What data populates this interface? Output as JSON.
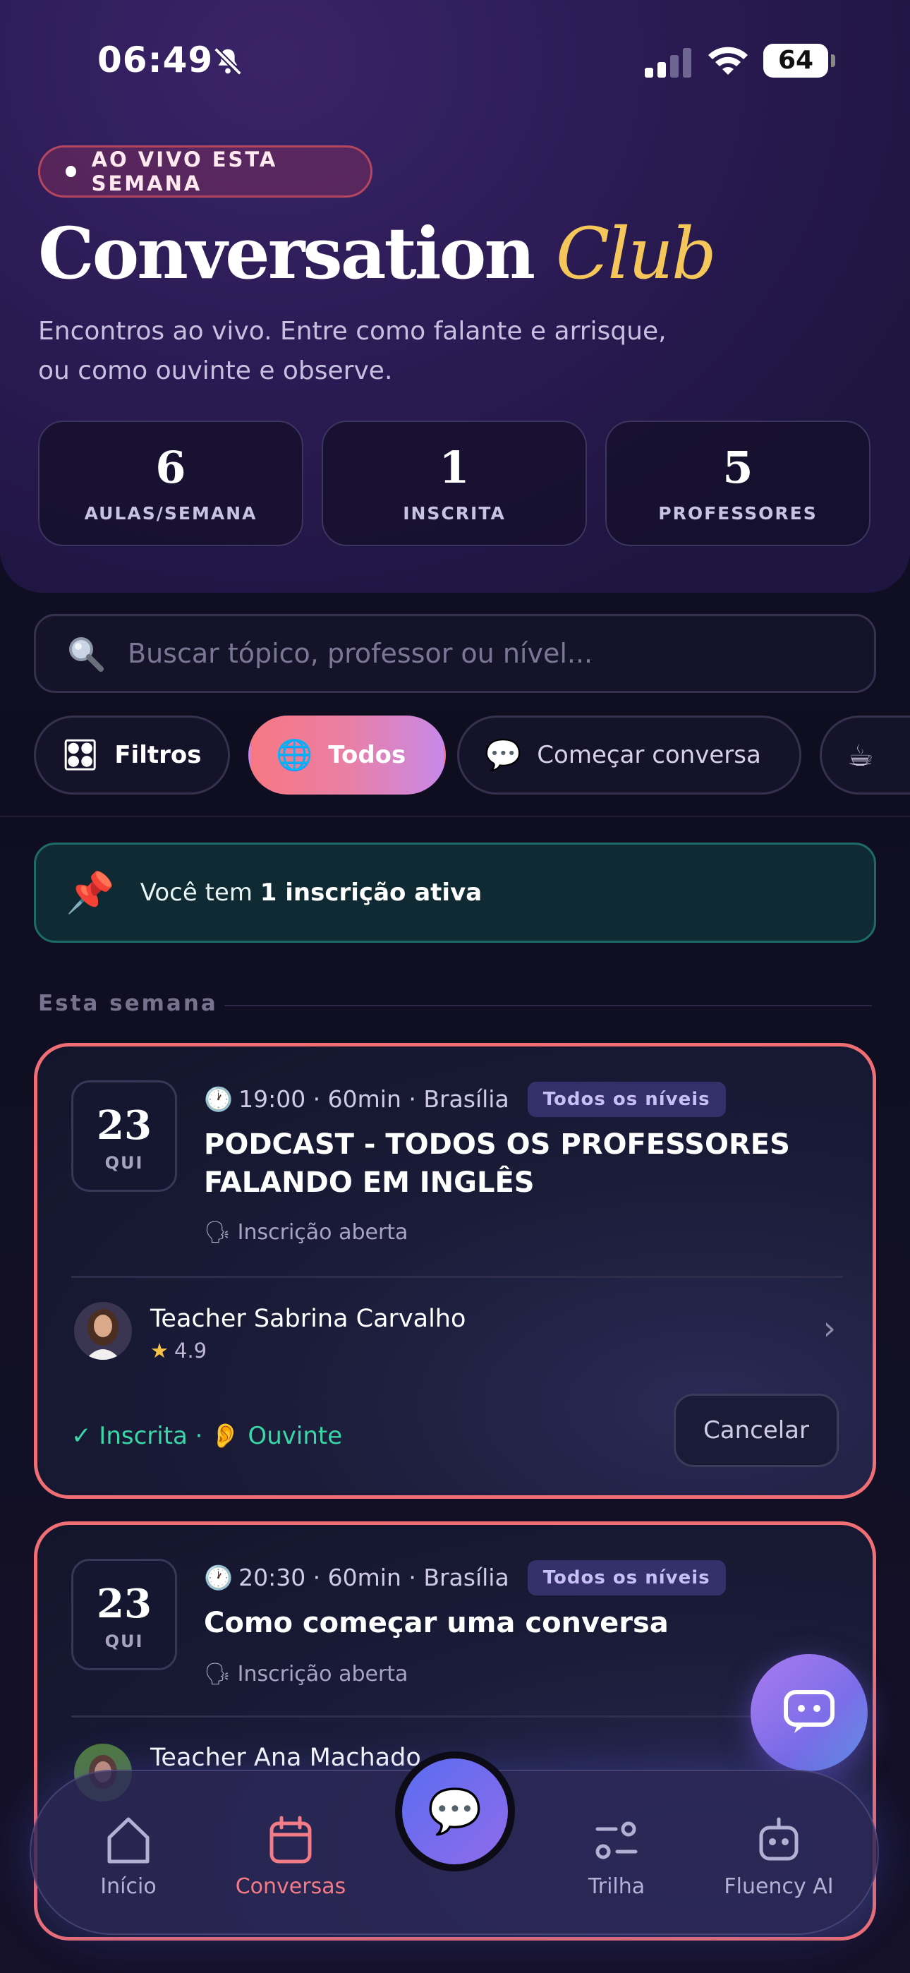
{
  "status_bar": {
    "time": "06:49",
    "battery": "64"
  },
  "hero": {
    "live_badge": "AO VIVO ESTA SEMANA",
    "title_main": "Conversation",
    "title_accent": "Club",
    "subtitle_line1": "Encontros ao vivo. Entre como falante e arrisque,",
    "subtitle_line2": "ou como ouvinte e observe.",
    "stats": [
      {
        "value": "6",
        "label": "AULAS/SEMANA"
      },
      {
        "value": "1",
        "label": "INSCRITA"
      },
      {
        "value": "5",
        "label": "PROFESSORES"
      }
    ]
  },
  "search": {
    "placeholder": "Buscar tópico, professor ou nível..."
  },
  "chips": [
    {
      "icon": "🎛",
      "label": "Filtros"
    },
    {
      "icon": "🌐",
      "label": "Todos"
    },
    {
      "icon": "💬",
      "label": "Começar conversa"
    },
    {
      "icon": "☕",
      "label": ""
    }
  ],
  "banner": {
    "prefix": "Você tem ",
    "bold": "1 inscrição ativa"
  },
  "section": {
    "title": "Esta semana"
  },
  "classes": [
    {
      "day": "23",
      "weekday": "QUI",
      "time": "19:00 · 60min · Brasília",
      "level": "Todos os níveis",
      "title_line1": "PODCAST - TODOS OS PROFESSORES",
      "title_line2": "FALANDO EM INGLÊS",
      "status": "Inscrição aberta",
      "teacher": "Teacher Sabrina Carvalho",
      "rating": "4.9",
      "enrolled_label": "✓ Inscrita · 👂 Ouvinte",
      "cancel_label": "Cancelar"
    },
    {
      "day": "23",
      "weekday": "QUI",
      "time": "20:30 · 60min · Brasília",
      "level": "Todos os níveis",
      "title_line1": "Como começar uma conversa",
      "status": "Inscrição aberta",
      "teacher": "Teacher Ana Machado"
    }
  ],
  "tabbar": {
    "items": [
      {
        "label": "Início",
        "icon": "home-icon"
      },
      {
        "label": "Conversas",
        "icon": "calendar-icon"
      },
      {
        "label": "Trilha",
        "icon": "path-icon"
      },
      {
        "label": "Fluency AI",
        "icon": "robot-icon"
      }
    ]
  },
  "colors": {
    "accent": "#ef6f75",
    "gold": "#f5c65a",
    "teal": "#39d6a8",
    "active_tab": "#f27b86"
  }
}
